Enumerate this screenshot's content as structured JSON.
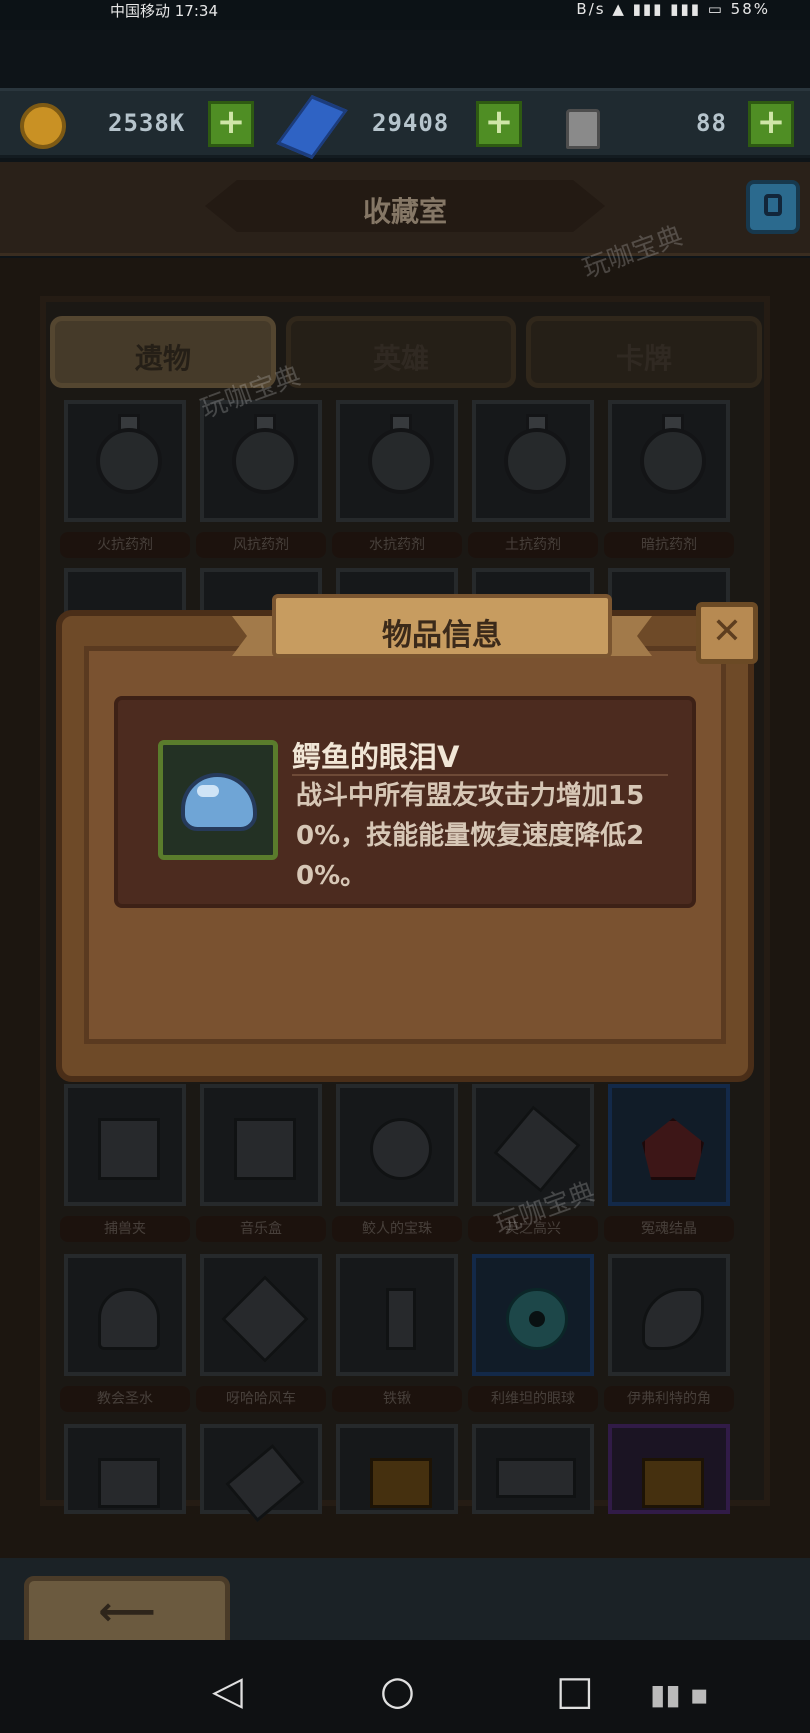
{
  "status": {
    "carrier": "中国移动 17:34",
    "right": "B/s ▲ ▮▮▮ ▮▮▮ ▭ 58%"
  },
  "resources": [
    {
      "icon": "coin-icon",
      "value": "2538K",
      "plus": "+"
    },
    {
      "icon": "gem-icon",
      "value": "29408",
      "plus": "+"
    },
    {
      "icon": "jar-icon",
      "value": "88",
      "plus": "+"
    }
  ],
  "header": {
    "title": "收藏室",
    "help_icon": "help-icon"
  },
  "tabs": [
    {
      "label": "遗物",
      "active": true
    },
    {
      "label": "英雄",
      "active": false
    },
    {
      "label": "卡牌",
      "active": false
    }
  ],
  "row1": [
    "火抗药剂",
    "风抗药剂",
    "水抗药剂",
    "土抗药剂",
    "暗抗药剂"
  ],
  "row_lower1": [
    "捕兽夹",
    "音乐盒",
    "鲛人的宝珠",
    "英之高兴",
    "冤魂结晶"
  ],
  "row_lower2": [
    "教会圣水",
    "呀哈哈风车",
    "铁锹",
    "利维坦的眼球",
    "伊弗利特的角"
  ],
  "dialog": {
    "title": "物品信息",
    "close": "✕",
    "item_name": "鳄鱼的眼泪V",
    "item_desc": "战斗中所有盟友攻击力增加150%，技能能量恢复速度降低20%。"
  },
  "bottom": {
    "back_label": "⟵"
  },
  "nav": {
    "back": "◁",
    "home": "○",
    "recent": "□",
    "extra": "▮▮ ▪"
  },
  "watermark": "玩咖宝典",
  "colors": {
    "accent_green": "#4f8e24",
    "wood": "#6e4a28",
    "panel": "#4c2b1f"
  }
}
